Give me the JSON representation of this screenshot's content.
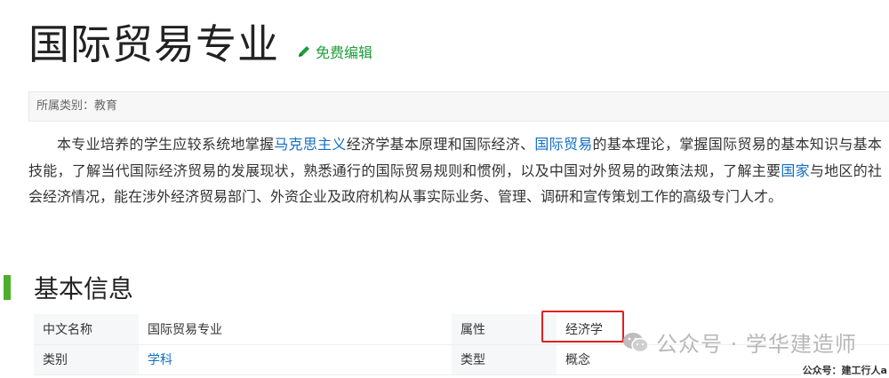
{
  "page": {
    "title": "国际贸易专业",
    "edit_label": "免费编辑",
    "category_label": "所属类别：教育"
  },
  "summary": {
    "parts": [
      {
        "text": "本专业培养的学生应较系统地掌握",
        "link": false
      },
      {
        "text": "马克思主义",
        "link": true
      },
      {
        "text": "经济学基本原理和国际经济、",
        "link": false
      },
      {
        "text": "国际贸易",
        "link": true
      },
      {
        "text": "的基本理论，掌握国际贸易的基本知识与基本技能，了解当代国际经济贸易的发展现状，熟悉通行的国际贸易规则和惯例，以及中国对外贸易的政策法规，了解主要",
        "link": false
      },
      {
        "text": "国家",
        "link": true
      },
      {
        "text": "与地区的社会经济情况，能在涉外经济贸易部门、外资企业及政府机构从事实际业务、管理、调研和宣传策划工作的高级专门人才。",
        "link": false
      }
    ]
  },
  "basic_info": {
    "title": "基本信息",
    "rows": [
      [
        {
          "key": "中文名称",
          "value": "国际贸易专业",
          "link": false
        },
        {
          "key": "属性",
          "value": "经济学",
          "link": false
        }
      ],
      [
        {
          "key": "类别",
          "value": "学科",
          "link": true
        },
        {
          "key": "类型",
          "value": "概念",
          "link": false
        }
      ]
    ]
  },
  "watermark": {
    "main": "公众号 · 学华建造师",
    "small": "公众号：建工行人a"
  },
  "colors": {
    "link": "#136ec2",
    "edit": "#1e9e3a",
    "section_bar": "#4caf2c",
    "highlight": "#e02020"
  }
}
